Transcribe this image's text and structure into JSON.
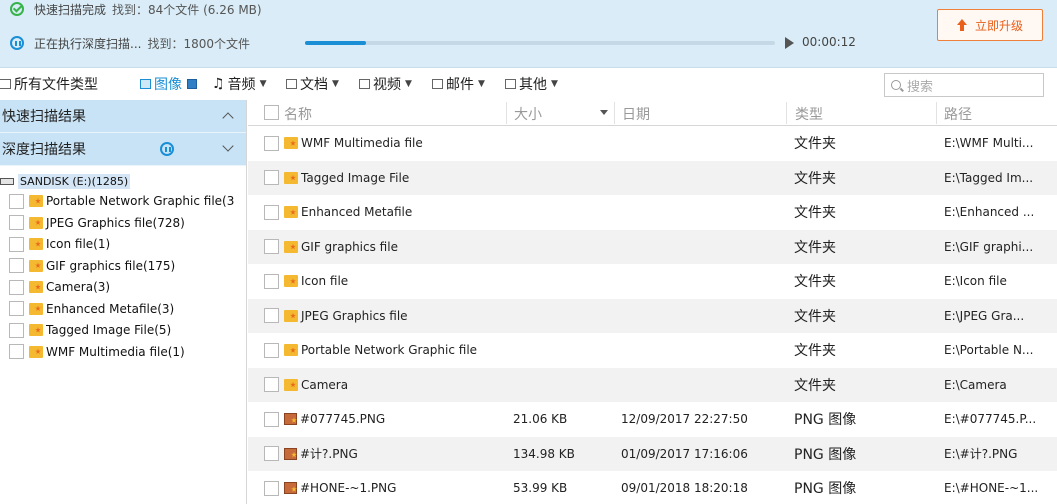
{
  "status": {
    "completed_text": "快速扫描完成",
    "completed_found": "找到：84个文件 (6.26 MB)",
    "running_text": "正在执行深度扫描...",
    "running_found": "找到：1800个文件",
    "progress_fraction": 0.13,
    "elapsed": "00:00:12",
    "upgrade_label": "立即升级"
  },
  "filter_bar": {
    "all_types": "所有文件类型",
    "items": [
      {
        "label": "图像"
      },
      {
        "label": "音频"
      },
      {
        "label": "文档"
      },
      {
        "label": "视频"
      },
      {
        "label": "邮件"
      },
      {
        "label": "其他"
      }
    ],
    "search_placeholder": "搜索"
  },
  "left_panel": {
    "quick_scan_header": "快速扫描结果",
    "deep_scan_header": "深度扫描结果",
    "drive_label": "SANDISK (E:)(1285)",
    "tree": [
      {
        "label": "Portable Network Graphic file(3"
      },
      {
        "label": "JPEG Graphics file(728)"
      },
      {
        "label": "Icon file(1)"
      },
      {
        "label": "GIF graphics file(175)"
      },
      {
        "label": "Camera(3)"
      },
      {
        "label": "Enhanced Metafile(3)"
      },
      {
        "label": "Tagged Image File(5)"
      },
      {
        "label": "WMF Multimedia file(1)"
      }
    ]
  },
  "table": {
    "columns": [
      "名称",
      "大小",
      "日期",
      "类型",
      "路径"
    ],
    "rows": [
      {
        "name": "WMF Multimedia file",
        "size": "",
        "date": "",
        "type": "文件夹",
        "path": "E:\\WMF Multi...",
        "icon": "folder-icon"
      },
      {
        "name": "Tagged Image File",
        "size": "",
        "date": "",
        "type": "文件夹",
        "path": "E:\\Tagged Im...",
        "icon": "folder-icon"
      },
      {
        "name": "Enhanced Metafile",
        "size": "",
        "date": "",
        "type": "文件夹",
        "path": "E:\\Enhanced ...",
        "icon": "folder-icon"
      },
      {
        "name": "GIF graphics file",
        "size": "",
        "date": "",
        "type": "文件夹",
        "path": "E:\\GIF graphi...",
        "icon": "folder-icon"
      },
      {
        "name": "Icon file",
        "size": "",
        "date": "",
        "type": "文件夹",
        "path": "E:\\Icon file",
        "icon": "folder-icon"
      },
      {
        "name": "JPEG Graphics file",
        "size": "",
        "date": "",
        "type": "文件夹",
        "path": "E:\\JPEG Gra...",
        "icon": "folder-icon"
      },
      {
        "name": "Portable Network Graphic file",
        "size": "",
        "date": "",
        "type": "文件夹",
        "path": "E:\\Portable N...",
        "icon": "folder-icon"
      },
      {
        "name": "Camera",
        "size": "",
        "date": "",
        "type": "文件夹",
        "path": "E:\\Camera",
        "icon": "folder-icon"
      },
      {
        "name": "#077745.PNG",
        "size": "21.06 KB",
        "date": "12/09/2017 22:27:50",
        "type": "PNG 图像",
        "path": "E:\\#077745.P...",
        "icon": "png-file-icon"
      },
      {
        "name": "#计?.PNG",
        "size": "134.98 KB",
        "date": "01/09/2017 17:16:06",
        "type": "PNG 图像",
        "path": "E:\\#计?.PNG",
        "icon": "png-file-icon"
      },
      {
        "name": "#HONE-~1.PNG",
        "size": "53.99 KB",
        "date": "09/01/2018 18:20:18",
        "type": "PNG 图像",
        "path": "E:\\#HONE-~1...",
        "icon": "png-file-icon"
      }
    ]
  },
  "colors": {
    "accent": "#1a8fd6",
    "status_bg": "#d9ecf7",
    "section_header_bg": "#c8e3f5",
    "upgrade_orange": "#e8601c",
    "success_green": "#38b34a"
  }
}
